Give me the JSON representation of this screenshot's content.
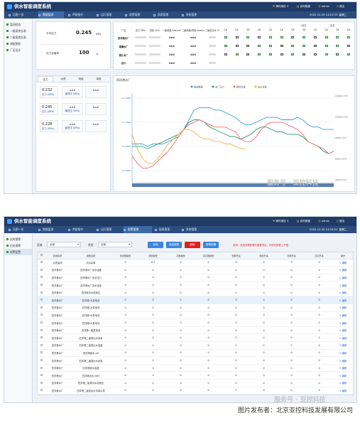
{
  "app": {
    "title": "供水智能调度系统"
  },
  "s1": {
    "header": {
      "alarm": "事件报告 3",
      "service": "实时数据",
      "user": "admin",
      "logout": "退出"
    },
    "menu": [
      "总图一览",
      "数据监测",
      "供配指令",
      "运行管理",
      "报警管理",
      "报表管理",
      "系统管理"
    ],
    "datetime": "2022-12-20 14:10:33",
    "weekday": "星期二",
    "sidebar": [
      "监测状态",
      "一级泵房总表",
      "二级泵房总表",
      "调度图形",
      "厂区设计"
    ],
    "kpi": [
      {
        "label": "平均压力",
        "value": "0.245",
        "unit": "MPa"
      },
      {
        "label": "压力合格率",
        "value": "100",
        "unit": "%"
      }
    ],
    "table_headers": [
      "厂站",
      "压力 MPa",
      "流量 m³/h",
      "一级电耗 KwH/m³",
      "二级电耗/药耗 KwH/m³",
      "二级泵出水 %"
    ],
    "pump_headers": [
      "1#",
      "2#",
      "3#",
      "4#",
      "1#",
      "2#",
      "3#",
      "4#",
      "1#",
      "2#",
      "3#",
      "4#"
    ],
    "pump_groups": [
      "一级泵",
      "二级泵"
    ],
    "rows": [
      {
        "name": "四洋港水厂",
        "vals": [
          "###",
          "###"
        ],
        "pumps": [
          1,
          0,
          1,
          0,
          1,
          1,
          0,
          1,
          0,
          1,
          1,
          1
        ]
      },
      {
        "name": "观澜水厂",
        "vals": [
          "###",
          "###"
        ],
        "pumps": [
          1,
          0,
          0,
          1,
          1,
          0,
          1,
          1,
          0,
          1,
          1,
          0
        ]
      },
      {
        "name": "银江水厂",
        "vals": [
          "###",
          "###"
        ],
        "pumps": [
          0,
          1,
          0,
          1,
          1,
          0,
          1,
          0,
          0,
          1,
          0,
          1
        ]
      },
      {
        "name": "总计",
        "vals": [
          "###",
          "###"
        ],
        "pumps": []
      }
    ],
    "tabs": [
      "压力",
      "水质",
      "电耗",
      "用电"
    ],
    "pressure_cells": [
      {
        "value": "0.232",
        "label": "压力   (MPa)"
      },
      {
        "value": "0.245",
        "label": "压力   (MPa)"
      },
      {
        "value": "0.228",
        "label": "压力   (MPa)"
      }
    ],
    "pressure_cells2": [
      {
        "label": "最低压   (MPa)"
      },
      {
        "label": "最低压   (MPa)"
      },
      {
        "label": "最低压   (MPa)"
      }
    ],
    "status_cells": [
      "###",
      "###",
      "###",
      "###",
      "###",
      "###"
    ],
    "chart_title": "四洋港水厂",
    "watermark": "服务号 · 亚控科技"
  },
  "chart_data": {
    "type": "line",
    "title": "四洋港水厂",
    "legend": [
      "原始数据",
      "出厂压力",
      "瞬时流量",
      "出水流量"
    ],
    "legend_position": "top-center",
    "y_left_ticks": [
      "0.4 MPa",
      "0.3 MPa",
      "0.2 MPa",
      "0.1 MPa"
    ],
    "y_right_ticks": [
      "12000 m³/h",
      "10000 m³/h",
      "8000 m³/h",
      "6000 m³/h",
      "4000 m³/h"
    ],
    "series": [
      {
        "color": "#3a9ad9",
        "values": [
          0.21,
          0.21,
          0.21,
          0.2,
          0.21,
          0.21,
          0.21,
          0.22,
          0.23,
          0.24,
          0.27,
          0.31,
          0.35,
          0.36,
          0.36,
          0.36,
          0.35,
          0.35,
          0.34,
          0.33,
          0.32,
          0.3,
          0.29,
          0.29,
          0.3,
          0.31,
          0.32,
          0.32,
          0.32,
          0.31,
          0.31,
          0.31,
          0.32,
          0.31,
          0.29,
          0.28,
          0.28,
          0.27,
          0.27,
          0.27
        ]
      },
      {
        "color": "#1f9e6a",
        "values": [
          0.2,
          0.2,
          0.2,
          0.19,
          0.2,
          0.21,
          0.22,
          0.23,
          0.24,
          0.25,
          0.27,
          0.3,
          0.31,
          0.31,
          0.3,
          0.28,
          0.27,
          0.26,
          0.25,
          0.24,
          0.24,
          0.23,
          0.24,
          0.25,
          0.27,
          0.28,
          0.28,
          0.27,
          0.26,
          0.26,
          0.25,
          0.25,
          0.25,
          0.24,
          0.22,
          0.21,
          0.2,
          0.18,
          0.17,
          0.18
        ]
      },
      {
        "color": "#f26b6b",
        "values": [
          0.16,
          0.13,
          0.11,
          0.11,
          0.12,
          0.14,
          0.16,
          0.18,
          0.21,
          0.24,
          0.27,
          0.29,
          0.3,
          0.31,
          0.3,
          0.29,
          0.28,
          0.28,
          0.28,
          0.27,
          0.26,
          0.23,
          0.22,
          0.22,
          0.24,
          0.27,
          0.29,
          0.3,
          0.3,
          0.3,
          0.29,
          0.28,
          0.27,
          0.25,
          0.22,
          0.21,
          0.2,
          0.19,
          0.17,
          0.18
        ]
      },
      {
        "color": "#f5b041",
        "values": [
          0.25,
          0.19,
          0.15,
          0.13,
          0.13,
          0.15,
          0.18,
          0.21,
          0.23,
          0.25,
          0.27,
          0.27,
          0.26,
          0.24,
          0.23,
          0.23,
          0.22,
          0.22,
          0.21,
          0.21,
          0.2,
          0.19,
          0.19,
          null,
          null,
          null,
          null,
          null,
          null,
          null,
          null,
          null,
          null,
          null,
          null,
          null,
          null,
          null,
          null,
          null
        ]
      }
    ]
  },
  "s2": {
    "header": {
      "alarm": "事件报告 3",
      "service": "实时数据",
      "user": "admin",
      "logout": "退出"
    },
    "menu": [
      "总图一览",
      "数据监测",
      "供配指令",
      "运行管理",
      "报警管理",
      "报表管理",
      "系统管理"
    ],
    "datetime": "2022-12-20 14:34:52",
    "weekday": "星期二",
    "sidebar": [
      "实时报警",
      "历史报警",
      "报警配置"
    ],
    "form": {
      "region_label": "区域",
      "region_value": "全部",
      "type_label": "类型",
      "type_value": "全部",
      "buttons": [
        "查询",
        "添加报警",
        "删除",
        "报警配置"
      ],
      "hint": "说明：请选择需配置的报警项目，可修改报警上下限"
    },
    "headers": [
      "",
      "区域名称",
      "报警名称",
      "低低限报警",
      "低限报警",
      "高限报警",
      "高高限报警",
      "低限开关",
      "低低开关",
      "高限开关",
      "高高开关",
      "操作"
    ],
    "rows": [
      [
        "水质监测",
        "清水余氯",
        "0",
        "0.3",
        "0",
        "0",
        "0",
        "0",
        "0",
        "0"
      ],
      [
        "四洋港水厂",
        "四洋港水厂出水浊度",
        "0",
        "0",
        "0",
        "0",
        "0",
        "0",
        "0",
        "0"
      ],
      [
        "四洋港水厂",
        "四洋港水厂出水压力",
        "0",
        "0",
        "0",
        "0",
        "0",
        "0",
        "0",
        "0"
      ],
      [
        "四洋港水厂",
        "四洋港水厂出水流量",
        "0",
        "0",
        "0",
        "0",
        "0",
        "0",
        "0",
        "0"
      ],
      [
        "四洋港水厂",
        "四洋港清水池液位",
        "0",
        "0",
        "0",
        "0",
        "0",
        "0",
        "0",
        "0"
      ],
      [
        "四洋港水厂",
        "四洋港1#泵电流",
        "0",
        "0",
        "0",
        "0",
        "0",
        "0",
        "0",
        "0"
      ],
      [
        "四洋港水厂",
        "四洋港2#泵电流",
        "0",
        "0",
        "0",
        "0",
        "0",
        "0",
        "0",
        "0"
      ],
      [
        "四洋港水厂",
        "四洋港3#泵电流",
        "0",
        "0",
        "0",
        "0",
        "0",
        "0",
        "0",
        "0"
      ],
      [
        "四洋港水厂",
        "四洋港4#泵电流",
        "0",
        "0",
        "0",
        "0",
        "0",
        "0",
        "0",
        "0"
      ],
      [
        "四洋港水厂",
        "四洋港一级泵电流",
        "0",
        "0",
        "0",
        "0",
        "0",
        "0",
        "0",
        "0"
      ],
      [
        "四洋港水厂",
        "四洋港二级泵出水流量",
        "0",
        "0",
        "0",
        "0",
        "0",
        "0",
        "0",
        "0"
      ],
      [
        "四洋港水厂",
        "四洋港二级泵出水浊度",
        "0",
        "0",
        "0",
        "0",
        "0",
        "0",
        "0",
        "0"
      ],
      [
        "四洋港水厂",
        "四洋港原水 pH",
        "0",
        "0",
        "0",
        "0",
        "0",
        "0",
        "0",
        "0"
      ],
      [
        "四洋港水厂",
        "四洋港二级泵出水余氯",
        "0",
        "0",
        "0",
        "0",
        "0",
        "0",
        "0",
        "0"
      ],
      [
        "四洋港水厂",
        "四洋港原水浊度",
        "0",
        "0",
        "0",
        "0",
        "0",
        "0",
        "0",
        "0"
      ],
      [
        "四洋港水厂",
        "四洋港出水 NH3",
        "0",
        "0",
        "0",
        "0",
        "0",
        "0",
        "0",
        "0"
      ],
      [
        "四洋港水厂",
        "四洋港二级泵清水池液位",
        "0",
        "0",
        "0",
        "0",
        "0",
        "0",
        "0",
        "0"
      ],
      [
        "四洋港水厂",
        "四洋港二级泵出水流量仪表",
        "0",
        "0",
        "0",
        "0",
        "0",
        "0",
        "0",
        "0"
      ]
    ],
    "op_label": "✎ 编辑",
    "watermark": "服务号 · 亚控科技"
  },
  "caption": "图片发布者：北京亚控科技发展有限公司"
}
